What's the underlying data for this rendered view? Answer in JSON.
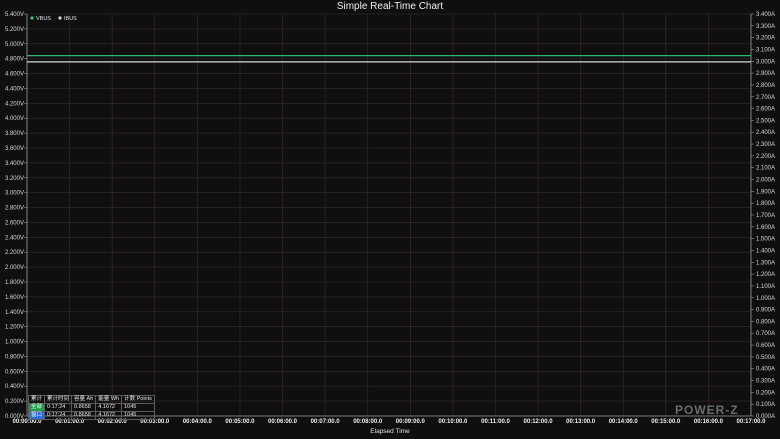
{
  "chart_data": {
    "type": "line",
    "title": "Simple Real-Time Chart",
    "xlabel": "Elapsed Time",
    "x_ticks": [
      "00:00:00.0",
      "00:01:00.0",
      "00:02:00.0",
      "00:03:00.0",
      "00:04:00.0",
      "00:05:00.0",
      "00:06:00.0",
      "00:07:00.0",
      "00:08:00.0",
      "00:09:00.0",
      "00:10:00.0",
      "00:11:00.0",
      "00:12:00.0",
      "00:13:00.0",
      "00:14:00.0",
      "00:15:00.0",
      "00:16:00.0",
      "00:17:00.0"
    ],
    "xlim_seconds": [
      0,
      1020
    ],
    "y_left": {
      "min": 0,
      "max": 5.4,
      "step": 0.2,
      "unit": "V",
      "decimals": 3
    },
    "y_right": {
      "min": 0,
      "max": 3.4,
      "step": 0.1,
      "unit": "A",
      "decimals": 3
    },
    "legend_position": "top-left",
    "grid": true,
    "series": [
      {
        "name": "VBUS",
        "color": "#2fd07a",
        "axis": "left",
        "x_seconds": [
          0,
          1044
        ],
        "values": [
          4.84,
          4.84
        ]
      },
      {
        "name": "IBUS",
        "color": "#d9d9d9",
        "axis": "right",
        "x_seconds": [
          0,
          1044
        ],
        "values": [
          2.995,
          2.995
        ]
      }
    ]
  },
  "stats_table": {
    "header": [
      "累计",
      "累计时间",
      "容量 Ah",
      "能量 Wh",
      "计数 Points"
    ],
    "rows": [
      {
        "tag": "全部",
        "time": "0:17:24",
        "ah": "0.8658",
        "wh": "4.1672",
        "points": "1045"
      },
      {
        "tag": "窗口",
        "time": "0:17:24",
        "ah": "0.8658",
        "wh": "4.1672",
        "points": "1045"
      }
    ]
  },
  "logo_text": "POWER-Z",
  "colors": {
    "background": "#0f0f0f",
    "grid": "#3a2a2a",
    "axis": "#9a9a9a"
  }
}
